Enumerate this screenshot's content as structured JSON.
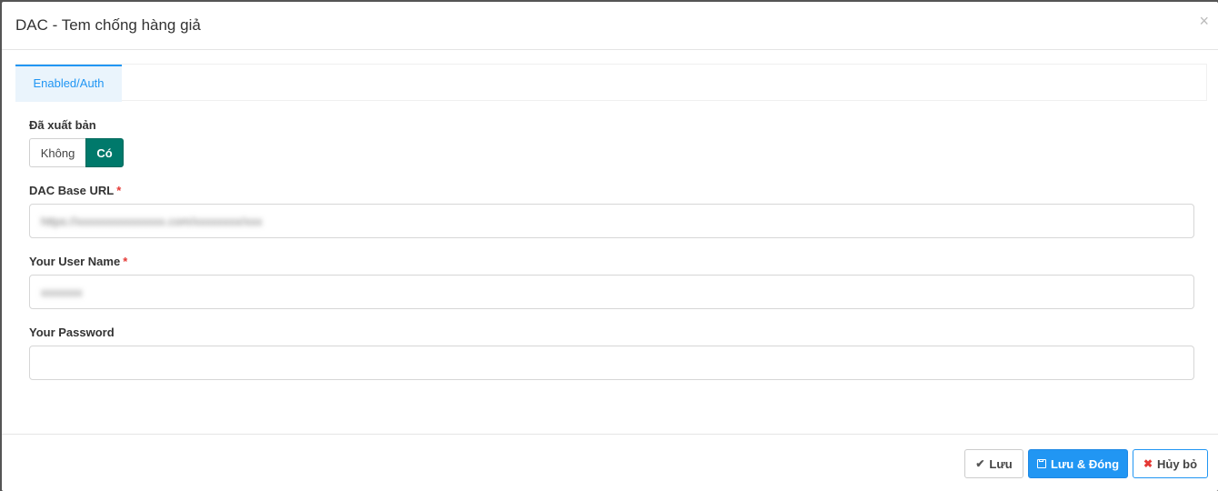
{
  "modal": {
    "title": "DAC - Tem chống hàng giả",
    "close_glyph": "×"
  },
  "tabs": [
    {
      "label": "Enabled/Auth",
      "active": true
    }
  ],
  "form": {
    "published": {
      "label": "Đã xuất bản",
      "options": [
        "Không",
        "Có"
      ],
      "selected": "Có"
    },
    "base_url": {
      "label": "DAC Base URL",
      "required": true,
      "value": "https://xxxxxxxxxxxxxxx.com/xxxxxxxx/xxx"
    },
    "user_name": {
      "label": "Your User Name",
      "required": true,
      "value": "xxxxxxx"
    },
    "password": {
      "label": "Your Password",
      "required": false,
      "value": ""
    },
    "required_mark": "*"
  },
  "footer": {
    "save_label": "Lưu",
    "save_close_label": "Lưu & Đóng",
    "cancel_label": "Hủy bỏ"
  },
  "icons": {
    "save": "check-icon",
    "save_close": "floppy-disk-icon",
    "cancel": "times-icon",
    "close": "close-icon"
  },
  "colors": {
    "accent": "#2196f3",
    "toggle_on": "#00796b",
    "required": "#e53935"
  }
}
